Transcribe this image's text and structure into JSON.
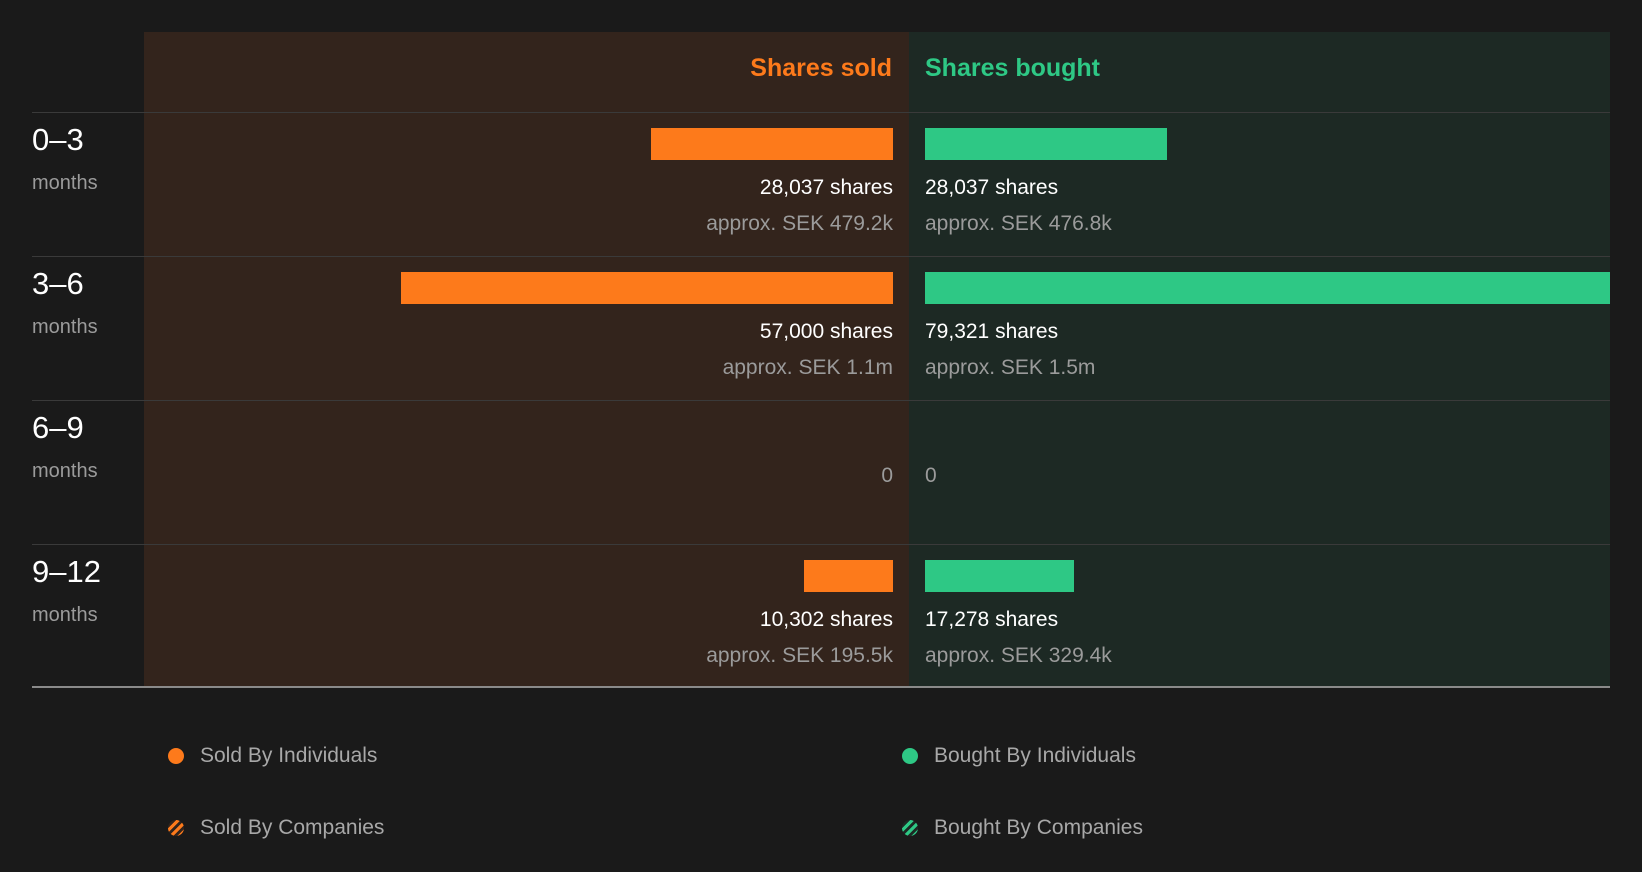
{
  "chart_data": {
    "type": "bar",
    "orientation": "horizontal-diverging",
    "columns": {
      "sold": "Shares sold",
      "bought": "Shares bought"
    },
    "rows": [
      {
        "period": "0–3",
        "unit": "months",
        "sold_shares": 28037,
        "sold_label": "28,037 shares",
        "sold_approx": "approx. SEK 479.2k",
        "bought_shares": 28037,
        "bought_label": "28,037 shares",
        "bought_approx": "approx. SEK 476.8k"
      },
      {
        "period": "3–6",
        "unit": "months",
        "sold_shares": 57000,
        "sold_label": "57,000 shares",
        "sold_approx": "approx. SEK 1.1m",
        "bought_shares": 79321,
        "bought_label": "79,321 shares",
        "bought_approx": "approx. SEK 1.5m"
      },
      {
        "period": "6–9",
        "unit": "months",
        "sold_shares": 0,
        "sold_label": "0",
        "sold_approx": "",
        "bought_shares": 0,
        "bought_label": "0",
        "bought_approx": ""
      },
      {
        "period": "9–12",
        "unit": "months",
        "sold_shares": 10302,
        "sold_label": "10,302 shares",
        "sold_approx": "approx. SEK 195.5k",
        "bought_shares": 17278,
        "bought_label": "17,278 shares",
        "bought_approx": "approx. SEK 329.4k"
      }
    ],
    "max_shares": 79321,
    "legend": [
      {
        "label": "Sold By Individuals",
        "color": "#fd7a1b",
        "style": "solid"
      },
      {
        "label": "Bought By Individuals",
        "color": "#2ec885",
        "style": "solid"
      },
      {
        "label": "Sold By Companies",
        "color": "#fd7a1b",
        "style": "hatched"
      },
      {
        "label": "Bought By Companies",
        "color": "#2ec885",
        "style": "hatched"
      }
    ],
    "colors": {
      "sold": "#fd7a1b",
      "bought": "#2ec885",
      "sold_bg": "#33241c",
      "bought_bg": "#1d2924"
    }
  }
}
